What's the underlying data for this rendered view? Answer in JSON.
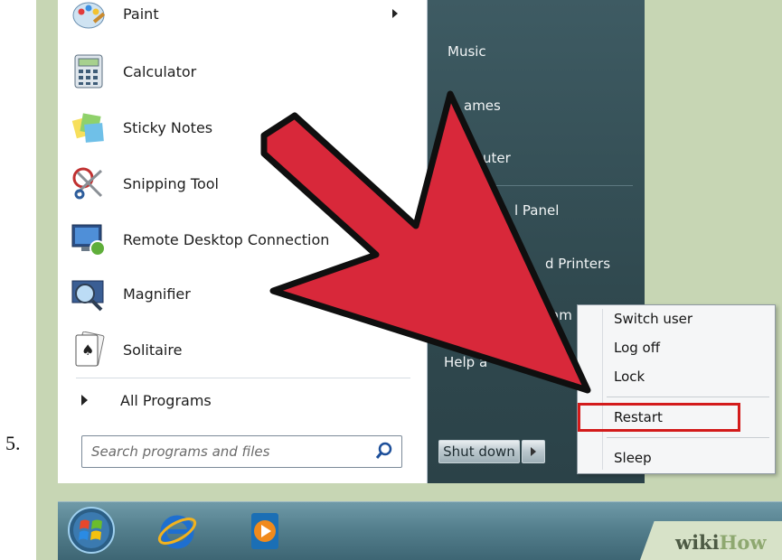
{
  "step_number": "5.",
  "start_menu": {
    "programs": [
      {
        "label": "Paint",
        "icon": "paint-icon",
        "has_submenu": true
      },
      {
        "label": "Calculator",
        "icon": "calculator-icon"
      },
      {
        "label": "Sticky Notes",
        "icon": "sticky-notes-icon"
      },
      {
        "label": "Snipping Tool",
        "icon": "snipping-tool-icon"
      },
      {
        "label": "Remote Desktop Connection",
        "icon": "remote-desktop-icon"
      },
      {
        "label": "Magnifier",
        "icon": "magnifier-icon"
      },
      {
        "label": "Solitaire",
        "icon": "solitaire-icon"
      }
    ],
    "all_programs_label": "All Programs",
    "search": {
      "placeholder": "Search programs and files",
      "icon": "search-icon"
    },
    "right_panel": {
      "items": [
        {
          "label": "Music"
        },
        {
          "label": "ames"
        },
        {
          "label": "nputer"
        },
        {
          "label": "l Panel"
        },
        {
          "label": "d Printers"
        },
        {
          "label": "am"
        },
        {
          "label": "Help a"
        }
      ],
      "shutdown_label": "Shut down"
    },
    "power_submenu": {
      "items": [
        {
          "label": "Switch user"
        },
        {
          "label": "Log off"
        },
        {
          "label": "Lock"
        },
        {
          "label": "Restart",
          "highlighted": true
        },
        {
          "label": "Sleep"
        }
      ]
    }
  },
  "taskbar": {
    "items": [
      {
        "icon": "windows-start-orb-icon"
      },
      {
        "icon": "internet-explorer-icon"
      },
      {
        "icon": "windows-media-player-icon"
      }
    ]
  },
  "watermark": {
    "wiki": "wiki",
    "how": "How"
  },
  "colors": {
    "arrow": "#d8283a",
    "highlight": "#d31b1b",
    "panel_dark": "#34505a"
  }
}
